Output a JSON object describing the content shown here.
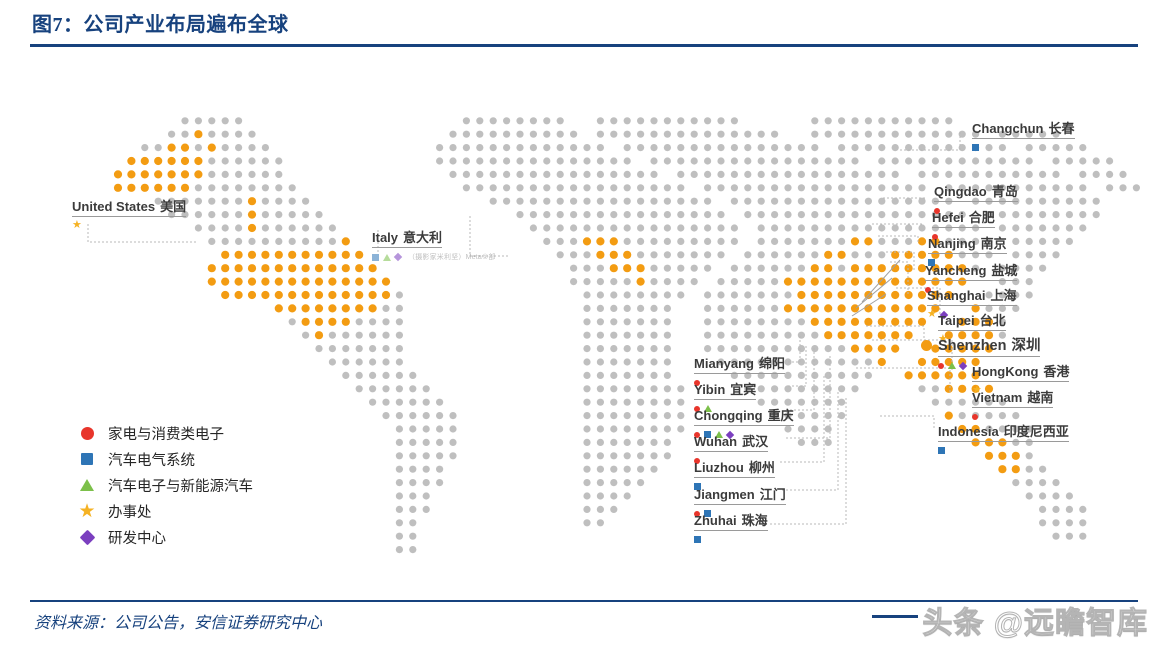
{
  "header": {
    "title": "图7：公司产业布局遍布全球"
  },
  "footer": {
    "source": "资料来源：公司公告，安信证券研究中心",
    "watermark": "头条 @远瞻智库"
  },
  "legend": {
    "items": [
      {
        "marker": "circle",
        "color": "#E8352B",
        "label": "家电与消费类电子"
      },
      {
        "marker": "square",
        "color": "#2E75B6",
        "label": "汽车电气系统"
      },
      {
        "marker": "triangle",
        "color": "#7CC04A",
        "label": "汽车电子与新能源汽车"
      },
      {
        "marker": "star",
        "color": "#F5B223",
        "label": "办事处"
      },
      {
        "marker": "diamond",
        "color": "#7B3FBF",
        "label": "研发中心"
      }
    ]
  },
  "map": {
    "colors": {
      "land_dot": "#BFBFBF",
      "highlight_dot": "#F39C12",
      "leader_line": "#B7B7B7",
      "title_blue": "#17427E"
    },
    "labels": [
      {
        "en": "United States",
        "cn": "美国",
        "marks": [
          "star"
        ],
        "marks_pos": "below"
      },
      {
        "en": "Italy",
        "cn": "意大利",
        "marks": [
          "square",
          "triangle",
          "diamond"
        ],
        "marks_pos": "below"
      },
      {
        "en": "Changchun",
        "cn": "长春",
        "marks": [
          "square"
        ],
        "marks_pos": "below"
      },
      {
        "en": "Qingdao",
        "cn": "青岛",
        "marks": [
          "circle"
        ],
        "marks_pos": "below"
      },
      {
        "en": "Hefei",
        "cn": "合肥",
        "marks": [
          "circle"
        ],
        "marks_pos": "below"
      },
      {
        "en": "Nanjing",
        "cn": "南京",
        "marks": [
          "square"
        ],
        "marks_pos": "below"
      },
      {
        "en": "Yancheng",
        "cn": "盐城",
        "marks": [
          "circle"
        ],
        "marks_pos": "below"
      },
      {
        "en": "Shanghai",
        "cn": "上海",
        "marks": [
          "star",
          "diamond"
        ],
        "marks_pos": "below"
      },
      {
        "en": "Taipei",
        "cn": "台北",
        "marks": [
          "star"
        ],
        "marks_pos": "below"
      },
      {
        "en": "Shenzhen",
        "cn": "深圳",
        "marks": [
          "circle",
          "triangle",
          "diamond"
        ],
        "marks_pos": "below"
      },
      {
        "en": "HongKong",
        "cn": "香港",
        "marks": [
          "star"
        ],
        "marks_pos": "below"
      },
      {
        "en": "Vietnam",
        "cn": "越南",
        "marks": [
          "circle"
        ],
        "marks_pos": "below"
      },
      {
        "en": "Indonesia",
        "cn": "印度尼西亚",
        "marks": [
          "square"
        ],
        "marks_pos": "below"
      },
      {
        "en": "Mianyang",
        "cn": "绵阳",
        "marks": [
          "circle"
        ],
        "marks_pos": "below"
      },
      {
        "en": "Yibin",
        "cn": "宜宾",
        "marks": [
          "circle",
          "triangle"
        ],
        "marks_pos": "below"
      },
      {
        "en": "Chongqing",
        "cn": "重庆",
        "marks": [
          "circle",
          "square",
          "triangle",
          "diamond"
        ],
        "marks_pos": "below"
      },
      {
        "en": "Wuhan",
        "cn": "武汉",
        "marks": [
          "circle"
        ],
        "marks_pos": "below"
      },
      {
        "en": "Liuzhou",
        "cn": "柳州",
        "marks": [
          "square"
        ],
        "marks_pos": "below"
      },
      {
        "en": "Jiangmen",
        "cn": "江门",
        "marks": [
          "circle",
          "square"
        ],
        "marks_pos": "below"
      },
      {
        "en": "Zhuhai",
        "cn": "珠海",
        "marks": [
          "square"
        ],
        "marks_pos": "below"
      }
    ],
    "italy_watermark": "（摄影家米利坚）Meta①部"
  }
}
